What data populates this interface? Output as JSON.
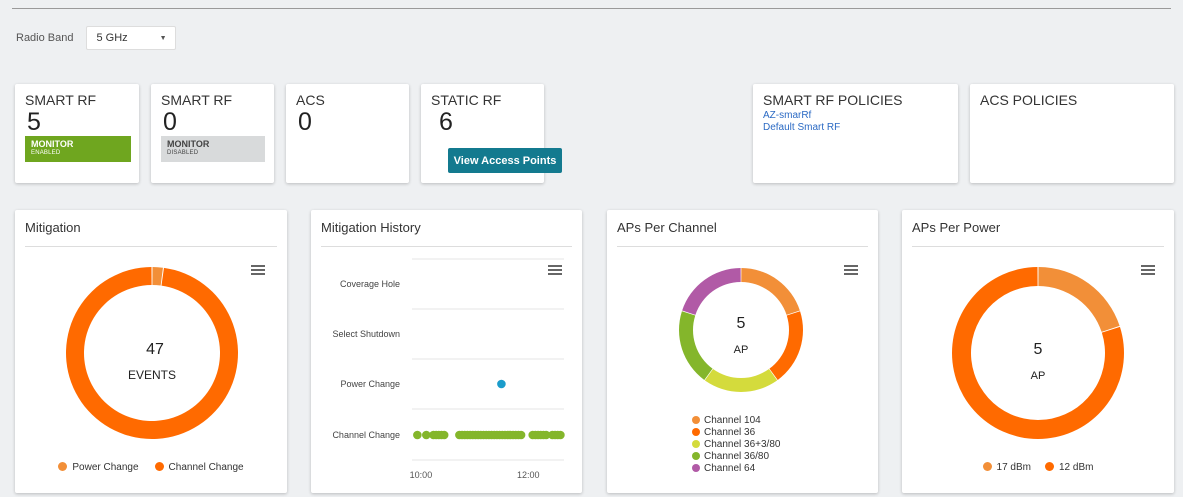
{
  "radio_band": {
    "label": "Radio Band",
    "value": "5 GHz"
  },
  "stats": {
    "smart_rf_enabled": {
      "title": "SMART RF",
      "count": "5",
      "status": "MONITOR",
      "sub": "ENABLED"
    },
    "smart_rf_disabled": {
      "title": "SMART RF",
      "count": "0",
      "status": "MONITOR",
      "sub": "DISABLED"
    },
    "acs": {
      "title": "ACS",
      "count": "0"
    },
    "static_rf": {
      "title": "STATIC RF",
      "count": "6",
      "button": "View Access Points"
    }
  },
  "policies": {
    "smart_rf": {
      "title": "SMART RF POLICIES",
      "links": [
        "AZ-smarRf",
        "Default Smart RF"
      ]
    },
    "acs": {
      "title": "ACS POLICIES"
    }
  },
  "colors": {
    "accent_orange": "#ff6a00",
    "light_orange": "#f28f38",
    "yellow_green": "#d4db3c",
    "green": "#84b62b",
    "purple": "#b15aa6",
    "teal": "#1b9ccb",
    "button_teal": "#137a8f",
    "enabled_green": "#6fa61f"
  },
  "icons": {
    "panel_menu": "hamburger-menu-icon",
    "dropdown": "caret-down-icon"
  },
  "chart_data": [
    {
      "type": "pie",
      "title": "Mitigation",
      "center_value": "47",
      "center_label": "EVENTS",
      "series": [
        {
          "name": "Power Change",
          "value": 1,
          "color": "#f28f38"
        },
        {
          "name": "Channel Change",
          "value": 46,
          "color": "#ff6a00"
        }
      ]
    },
    {
      "type": "scatter",
      "title": "Mitigation History",
      "categories": [
        "Coverage Hole",
        "Select Shutdown",
        "Power Change",
        "Channel Change"
      ],
      "x_ticks": [
        "10:00",
        "12:00"
      ],
      "xlim_min": [
        590,
        760
      ],
      "series": [
        {
          "name": "Power Change",
          "color": "#1b9ccb",
          "points": [
            [
              690,
              "Power Change"
            ]
          ]
        },
        {
          "name": "Channel Change",
          "color": "#84b62b",
          "points": [
            [
              596,
              "Channel Change"
            ],
            [
              606,
              "Channel Change"
            ],
            [
              614,
              "Channel Change"
            ],
            [
              617,
              "Channel Change"
            ],
            [
              620,
              "Channel Change"
            ],
            [
              623,
              "Channel Change"
            ],
            [
              626,
              "Channel Change"
            ],
            [
              643,
              "Channel Change"
            ],
            [
              646,
              "Channel Change"
            ],
            [
              649,
              "Channel Change"
            ],
            [
              652,
              "Channel Change"
            ],
            [
              655,
              "Channel Change"
            ],
            [
              658,
              "Channel Change"
            ],
            [
              661,
              "Channel Change"
            ],
            [
              664,
              "Channel Change"
            ],
            [
              667,
              "Channel Change"
            ],
            [
              670,
              "Channel Change"
            ],
            [
              673,
              "Channel Change"
            ],
            [
              676,
              "Channel Change"
            ],
            [
              679,
              "Channel Change"
            ],
            [
              682,
              "Channel Change"
            ],
            [
              685,
              "Channel Change"
            ],
            [
              688,
              "Channel Change"
            ],
            [
              691,
              "Channel Change"
            ],
            [
              694,
              "Channel Change"
            ],
            [
              697,
              "Channel Change"
            ],
            [
              700,
              "Channel Change"
            ],
            [
              703,
              "Channel Change"
            ],
            [
              706,
              "Channel Change"
            ],
            [
              709,
              "Channel Change"
            ],
            [
              712,
              "Channel Change"
            ],
            [
              725,
              "Channel Change"
            ],
            [
              728,
              "Channel Change"
            ],
            [
              731,
              "Channel Change"
            ],
            [
              734,
              "Channel Change"
            ],
            [
              737,
              "Channel Change"
            ],
            [
              740,
              "Channel Change"
            ],
            [
              747,
              "Channel Change"
            ],
            [
              750,
              "Channel Change"
            ],
            [
              753,
              "Channel Change"
            ],
            [
              756,
              "Channel Change"
            ]
          ]
        }
      ]
    },
    {
      "type": "pie",
      "title": "APs Per Channel",
      "center_value": "5",
      "center_label": "AP",
      "series": [
        {
          "name": "Channel 104",
          "value": 1,
          "color": "#f28f38"
        },
        {
          "name": "Channel 36",
          "value": 1,
          "color": "#ff6a00"
        },
        {
          "name": "Channel 36+3/80",
          "value": 1,
          "color": "#d4db3c"
        },
        {
          "name": "Channel 36/80",
          "value": 1,
          "color": "#84b62b"
        },
        {
          "name": "Channel 64",
          "value": 1,
          "color": "#b15aa6"
        }
      ]
    },
    {
      "type": "pie",
      "title": "APs Per Power",
      "center_value": "5",
      "center_label": "AP",
      "series": [
        {
          "name": "17 dBm",
          "value": 1,
          "color": "#f28f38"
        },
        {
          "name": "12 dBm",
          "value": 4,
          "color": "#ff6a00"
        }
      ]
    }
  ]
}
